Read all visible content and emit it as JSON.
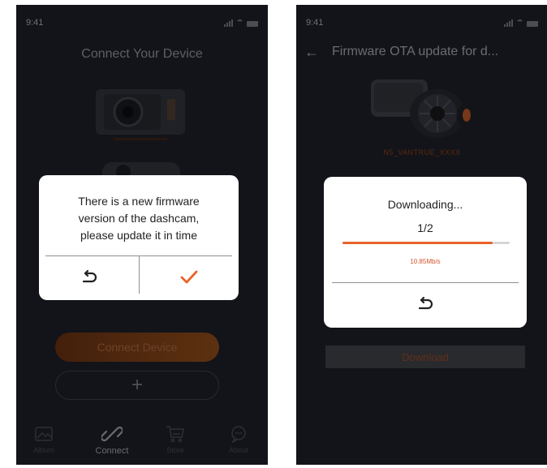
{
  "left_screen": {
    "status_time": "9:41",
    "title": "Connect Your Device",
    "dialog": {
      "message_line1": "There is a new firmware",
      "message_line2": "version of the dashcam,",
      "message_line3": "please update it in time",
      "cancel_icon": "undo-arrow-icon",
      "confirm_icon": "checkmark-icon"
    },
    "connect_button": "Connect Device",
    "add_button": "+",
    "tabs": [
      {
        "label": "Album",
        "icon": "album-icon"
      },
      {
        "label": "Connect",
        "icon": "link-icon"
      },
      {
        "label": "Store",
        "icon": "cart-icon"
      },
      {
        "label": "About",
        "icon": "chat-icon"
      }
    ]
  },
  "right_screen": {
    "status_time": "9:41",
    "title": "Firmware OTA update for d...",
    "device_name": "N5_VANTRUE_XXXX",
    "dialog": {
      "heading": "Downloading...",
      "step": "1/2",
      "progress": 0.9,
      "speed": "10.85Mb/s",
      "back_icon": "undo-arrow-icon"
    },
    "download_button": "Download"
  },
  "colors": {
    "background": "#23252f",
    "accent": "#e8632a",
    "dialog": "#ffffff"
  }
}
